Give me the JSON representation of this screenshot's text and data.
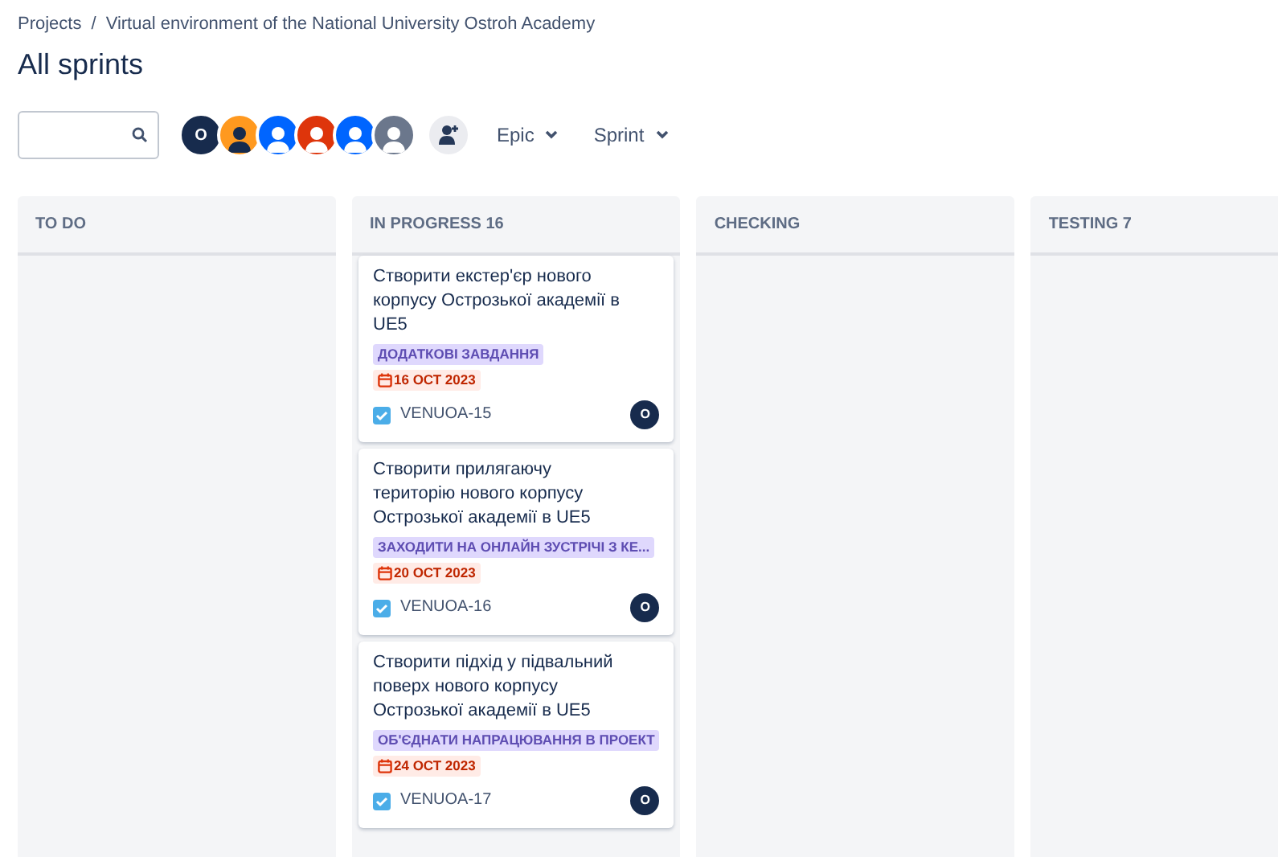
{
  "breadcrumbs": [
    "Projects",
    "Virtual environment of the National University Ostroh Academy"
  ],
  "breadcrumb_separator": "/",
  "title": "All sprints",
  "avatars": [
    {
      "kind": "initial",
      "text": "O",
      "color": "#172b4d"
    },
    {
      "kind": "person",
      "color": "#ff991f"
    },
    {
      "kind": "person",
      "color": "#0065ff"
    },
    {
      "kind": "person",
      "color": "#de350b"
    },
    {
      "kind": "person",
      "color": "#0065ff"
    },
    {
      "kind": "person",
      "color": "#6b778c"
    }
  ],
  "filters": [
    "Epic",
    "Sprint"
  ],
  "columns": [
    {
      "title": "TO DO"
    },
    {
      "title": "IN PROGRESS 16",
      "cards": [
        {
          "summary": "Створити екстер'єр нового корпусу Острозької академії в UE5",
          "epic": "ДОДАТКОВІ ЗАВДАННЯ",
          "due": "16 ОСТ 2023",
          "key": "VENUOA-15",
          "assignee": "O"
        },
        {
          "summary": "Створити прилягаючу територію нового корпусу Острозької академії в UE5",
          "epic": "ЗАХОДИТИ НА ОНЛАЙН ЗУСТРІЧІ З КЕ...",
          "due": "20 ОСТ 2023",
          "key": "VENUOA-16",
          "assignee": "O"
        },
        {
          "summary": "Створити підхід у підвальний поверх нового корпусу Острозької академії в UE5",
          "epic": "ОБ'ЄДНАТИ НАПРАЦЮВАННЯ В ПРОЕКТ",
          "due": "24 ОСТ 2023",
          "key": "VENUOA-17",
          "assignee": "O"
        }
      ]
    },
    {
      "title": "CHECKING"
    },
    {
      "title": "TESTING 7"
    }
  ]
}
